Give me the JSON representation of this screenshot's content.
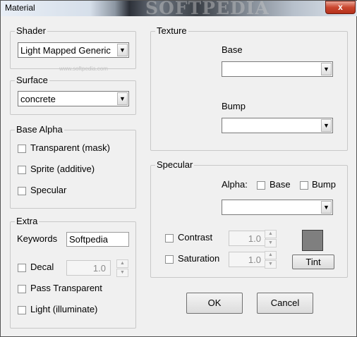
{
  "window": {
    "title": "Material",
    "watermark": "SOFTPEDIA",
    "watermark_small": "www.softpedia.com",
    "close_glyph": "x"
  },
  "shader": {
    "title": "Shader",
    "selected": "Light Mapped Generic"
  },
  "surface": {
    "title": "Surface",
    "selected": "concrete"
  },
  "base_alpha": {
    "title": "Base Alpha",
    "transparent": "Transparent (mask)",
    "sprite": "Sprite (additive)",
    "specular": "Specular"
  },
  "extra": {
    "title": "Extra",
    "keywords_label": "Keywords",
    "keywords_value": "Softpedia",
    "decal_label": "Decal",
    "decal_value": "1.0",
    "pass_transparent": "Pass Transparent",
    "light": "Light (illuminate)"
  },
  "texture": {
    "title": "Texture",
    "base_label": "Base",
    "base_value": "",
    "bump_label": "Bump",
    "bump_value": ""
  },
  "specular": {
    "title": "Specular",
    "alpha_label": "Alpha:",
    "alpha_base": "Base",
    "alpha_bump": "Bump",
    "select_value": "",
    "contrast_label": "Contrast",
    "contrast_value": "1.0",
    "saturation_label": "Saturation",
    "saturation_value": "1.0",
    "tint_label": "Tint",
    "tint_color": "#7f7f7f"
  },
  "buttons": {
    "ok": "OK",
    "cancel": "Cancel"
  },
  "icons": {
    "dropdown": "chevron-down-icon",
    "spin_up": "spin-up-icon",
    "spin_down": "spin-down-icon"
  }
}
